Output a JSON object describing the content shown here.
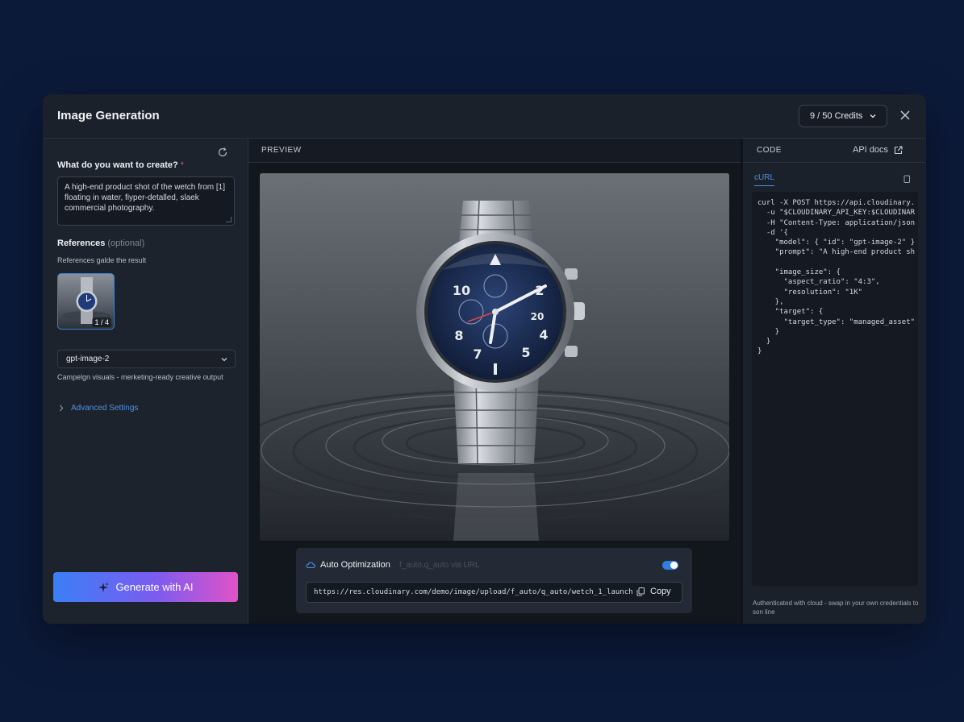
{
  "modal": {
    "title": "Image Generation",
    "credits": "9 / 50  Credits"
  },
  "left": {
    "question": "What do you want to create?",
    "required_mark": "*",
    "prompt": "A high-end product shot of the wetch from [1] floating in water, fiyper-detalled, slaek commercial photography.",
    "references_title": "References",
    "references_optional": "(optional)",
    "references_sub": "References galde the result",
    "thumb_badge": "1 / 4",
    "model": "gpt-image-2",
    "model_desc": "Campelgn visuals - merketing-ready creative output",
    "advanced": "Advanced Settings",
    "generate": "Generate with AI"
  },
  "center": {
    "preview_label": "PREVIEW",
    "auto_opt_title": "Auto Optimization",
    "auto_opt_hint": "f_auto,q_auto via URL",
    "auto_opt_enabled": true,
    "url": "https://res.cloudinary.com/demo/image/upload/f_auto/q_auto/wetch_1_launch",
    "copy": "Copy"
  },
  "right": {
    "code_label": "CODE",
    "api_docs": "API docs",
    "tab": "cURL",
    "code": "curl -X POST https://api.cloudinary.\n  -u \"$CLOUDINARY_API_KEY:$CLOUDINAR\n  -H \"Content-Type: application/json\n  -d '{\n    \"model\": { \"id\": \"gpt-image-2\" }\n    \"prompt\": \"A high-end product sh\n\n    \"image_size\": {\n      \"aspect_ratio\": \"4:3\",\n      \"resolution\": \"1K\"\n    },\n    \"target\": {\n      \"target_type\": \"managed_asset\"\n    }\n  }\n}",
    "auth_note": "Authenticated with cloud - swap in your own credentials to son line"
  },
  "colors": {
    "background": "#0c1a3a",
    "accent": "#4f8fe0",
    "gradient_start": "#3b7ff5",
    "gradient_end": "#e052c8"
  }
}
